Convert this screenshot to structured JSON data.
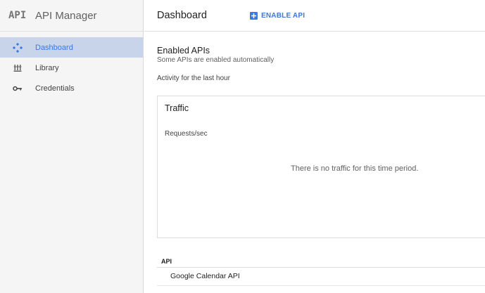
{
  "sidebar": {
    "logo": "API",
    "title": "API Manager",
    "items": [
      {
        "label": "Dashboard",
        "icon": "dashboard-diamond-icon",
        "active": true
      },
      {
        "label": "Library",
        "icon": "library-icon",
        "active": false
      },
      {
        "label": "Credentials",
        "icon": "key-icon",
        "active": false
      }
    ]
  },
  "header": {
    "title": "Dashboard",
    "enable_api_label": "ENABLE API",
    "enable_api_icon": "plus-box-icon"
  },
  "main": {
    "section_title": "Enabled APIs",
    "section_subtitle": "Some APIs are enabled automatically",
    "activity_label": "Activity for the last hour",
    "traffic_card": {
      "title": "Traffic",
      "axis_label": "Requests/sec",
      "empty_message": "There is no traffic for this time period."
    },
    "table": {
      "columns": [
        "API"
      ],
      "rows": [
        {
          "api": "Google Calendar API"
        }
      ]
    }
  },
  "colors": {
    "accent": "#3b78e7",
    "active_bg": "#c8d4ea",
    "sidebar_bg": "#f5f5f5"
  }
}
